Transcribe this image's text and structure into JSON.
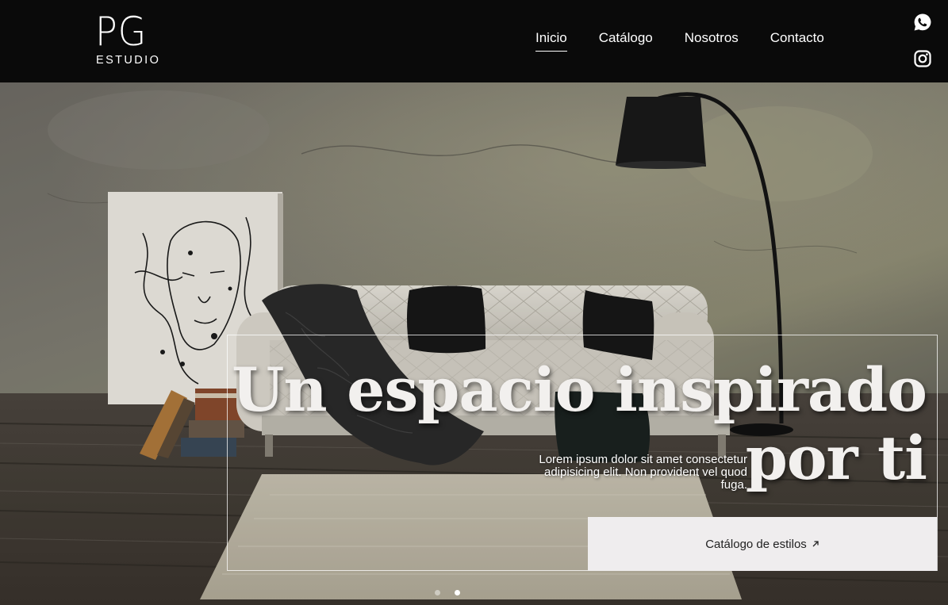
{
  "brand": {
    "mark": "PG",
    "sub": "ESTUDIO"
  },
  "nav": {
    "items": [
      {
        "label": "Inicio",
        "active": true
      },
      {
        "label": "Catálogo",
        "active": false
      },
      {
        "label": "Nosotros",
        "active": false
      },
      {
        "label": "Contacto",
        "active": false
      }
    ]
  },
  "social": {
    "icons": [
      "whatsapp-icon",
      "instagram-icon"
    ]
  },
  "hero": {
    "headline_line1": "Un espacio inspirado",
    "headline_line2": "por ti",
    "lead_line1": "Lorem ipsum dolor sit amet consectetur",
    "lead_line2": "adipisicing elit. Non provident vel quod",
    "lead_line3": "fuga.",
    "cta_label": "Catálogo de estilos",
    "cta_icon": "arrow-up-right-icon",
    "slides": {
      "count": 2,
      "active_index": 1
    }
  },
  "colors": {
    "header_bg": "#0a0a0a",
    "cta_bg": "#efedee",
    "text_light": "#ffffff"
  }
}
